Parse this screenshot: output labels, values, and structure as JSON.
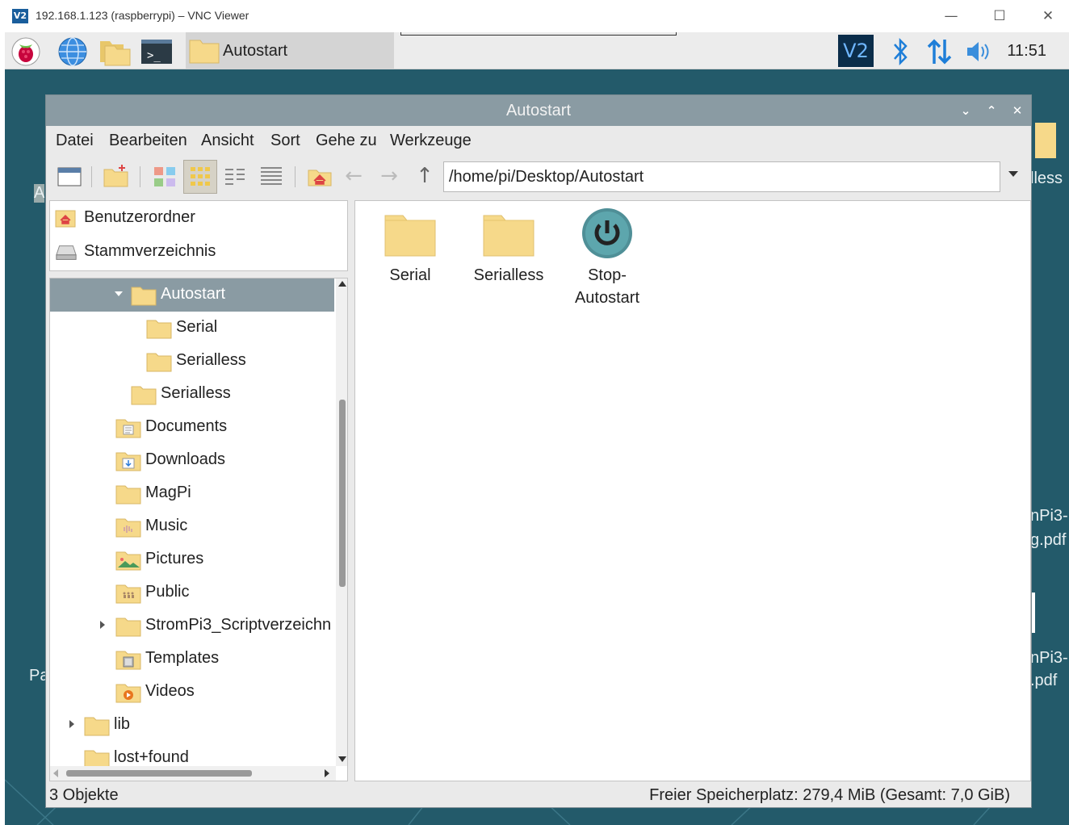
{
  "vnc": {
    "logo": "V2",
    "title": "192.168.1.123 (raspberrypi) – VNC Viewer",
    "minimize": "—",
    "maximize": "☐",
    "close": "✕"
  },
  "taskbar": {
    "task_label": "Autostart",
    "clock": "11:51",
    "vnc_tray": "V2"
  },
  "desktop": {
    "labels": [
      "lless",
      "A",
      "nPi3-",
      "g.pdf",
      "nPi3-",
      ".pdf",
      "Pa"
    ]
  },
  "window": {
    "title": "Autostart",
    "ctl_min": "⌄",
    "ctl_max": "⌃",
    "ctl_close": "✕"
  },
  "menu": [
    "Datei",
    "Bearbeiten",
    "Ansicht",
    "Sort",
    "Gehe zu",
    "Werkzeuge"
  ],
  "path": "/home/pi/Desktop/Autostart",
  "places": [
    {
      "label": "Benutzerordner",
      "icon": "home-icon"
    },
    {
      "label": "Stammverzeichnis",
      "icon": "drive-icon"
    }
  ],
  "tree": [
    {
      "label": "Autostart",
      "selected": true,
      "expanded": true
    },
    {
      "label": "Serial"
    },
    {
      "label": "Serialless"
    },
    {
      "label": "Serialless"
    },
    {
      "label": "Documents"
    },
    {
      "label": "Downloads"
    },
    {
      "label": "MagPi"
    },
    {
      "label": "Music"
    },
    {
      "label": "Pictures"
    },
    {
      "label": "Public"
    },
    {
      "label": "StromPi3_Scriptverzeichn",
      "expandable": true
    },
    {
      "label": "Templates"
    },
    {
      "label": "Videos"
    },
    {
      "label": "lib",
      "expandable": true
    },
    {
      "label": "lost+found"
    }
  ],
  "files": [
    {
      "line1": "Serial",
      "line2": "",
      "icon": "folder-icon"
    },
    {
      "line1": "Serialless",
      "line2": "",
      "icon": "folder-icon"
    },
    {
      "line1": "Stop-",
      "line2": "Autostart",
      "icon": "power-icon"
    }
  ],
  "status": {
    "left": "3 Objekte",
    "right": "Freier Speicherplatz: 279,4 MiB (Gesamt: 7,0 GiB)"
  },
  "colors": {
    "desktop": "#235a6a",
    "titlebar": "#8a9ba3",
    "folder": "#f6d98a"
  }
}
